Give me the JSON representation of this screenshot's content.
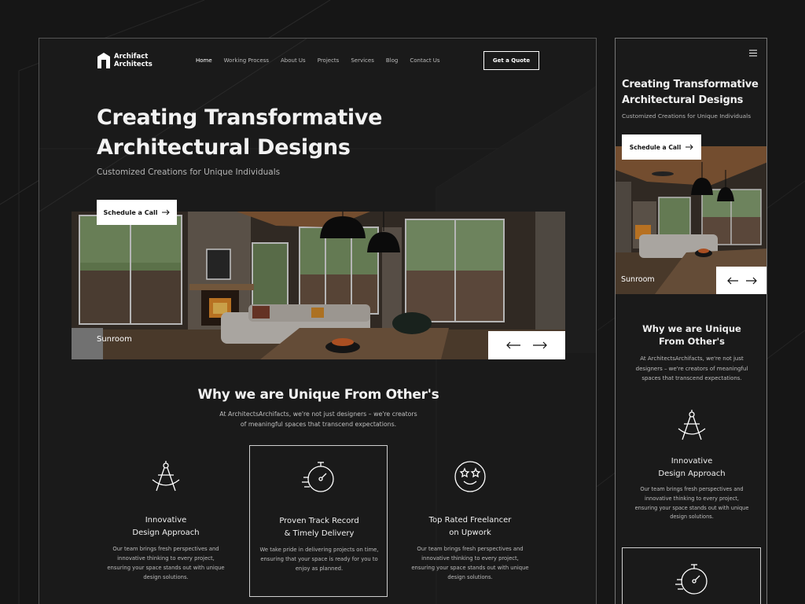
{
  "brand": {
    "name_line1": "Archifact",
    "name_line2": "Architects"
  },
  "nav": {
    "items": [
      "Home",
      "Working Process",
      "About Us",
      "Projects",
      "Services",
      "Blog",
      "Contact Us"
    ],
    "active": "Home",
    "cta_label": "Get a Quote"
  },
  "hero": {
    "title_line1": "Creating Transformative",
    "title_line2": "Architectural Designs",
    "subtitle": "Customized Creations for Unique Individuals",
    "cta_label": "Schedule a Call",
    "image_caption": "Sunroom"
  },
  "why": {
    "title": "Why we are Unique From Other's",
    "description": "At ArchitectsArchifacts, we're not just designers – we're creators of meaningful spaces that transcend expectations."
  },
  "features": [
    {
      "icon": "compass-icon",
      "title_line1": "Innovative",
      "title_line2": "Design Approach",
      "description": "Our team brings fresh perspectives and innovative thinking to every project, ensuring your space stands out with unique design solutions."
    },
    {
      "icon": "stopwatch-icon",
      "title_line1": "Proven Track Record",
      "title_line2": "& Timely Delivery",
      "description": "We take pride in delivering projects on time, ensuring that your space is ready for you to enjoy as planned."
    },
    {
      "icon": "star-eyes-smiley-icon",
      "title_line1": "Top Rated Freelancer",
      "title_line2": "on Upwork",
      "description": "Our team brings fresh perspectives and innovative thinking to every project, ensuring your space stands out with unique design solutions."
    }
  ],
  "mobile": {
    "title_line1": "Creating Transformative",
    "title_line2": "Architectural Designs",
    "subtitle": "Customized Creations for Unique Individuals",
    "cta_label": "Schedule a Call",
    "image_caption": "Sunroom",
    "why_line1": "Why we are Unique",
    "why_line2": "From Other's",
    "why_description": "At ArchitectsArchifacts, we're not just designers – we're creators of meaningful spaces that transcend expectations.",
    "feature_title_line1": "Innovative",
    "feature_title_line2": "Design Approach",
    "feature_description": "Our team brings fresh perspectives and innovative thinking to every project, ensuring your space stands out with unique design solutions."
  },
  "colors": {
    "background": "#161616",
    "panel": "#1a1a1a",
    "text": "#ffffff",
    "muted": "#b5b5b5",
    "button_bg": "#ffffff"
  }
}
